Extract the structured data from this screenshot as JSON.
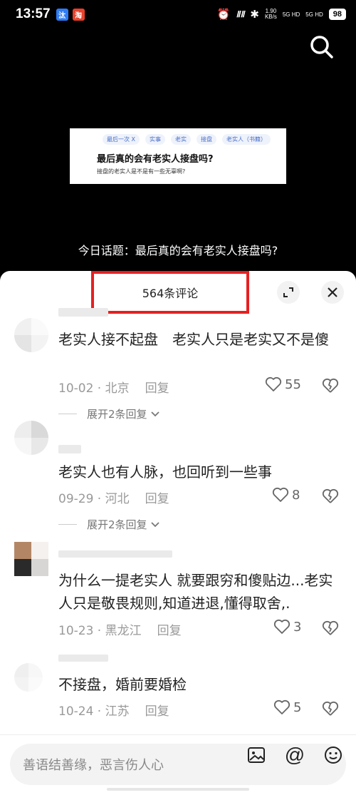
{
  "status": {
    "time": "13:57",
    "badge1": "汰",
    "badge2": "淘",
    "netspeed_top": "1.90",
    "netspeed_bottom": "KB/s",
    "signal1": "5G HD",
    "signal2": "5G HD",
    "battery": "98"
  },
  "video": {
    "tags": [
      "最后一次 X",
      "实事",
      "老实",
      "接盘",
      "老实人（书籍）"
    ],
    "title": "最后真的会有老实人接盘吗?",
    "subtitle": "接盘的老实人是不是有一些无辜啊?",
    "topic": "今日话题：最后真的会有老实人接盘吗?"
  },
  "panel": {
    "title": "564条评论"
  },
  "comments": [
    {
      "text": "老实人接不起盘　老实人只是老实又不是傻",
      "date": "10-02 · 北京",
      "reply": "回复",
      "likes": "55",
      "expand": "展开2条回复"
    },
    {
      "text": "老实人也有人脉，也回听到一些事",
      "date": "09-29 · 河北",
      "reply": "回复",
      "likes": "8",
      "expand": "展开2条回复"
    },
    {
      "text": "为什么一提老实人 就要跟穷和傻贴边...老实人只是敬畏规则,知道进退,懂得取舍,.",
      "date": "10-23 · 黑龙江",
      "reply": "回复",
      "likes": "3"
    },
    {
      "text": "不接盘，婚前要婚检",
      "date": "10-24 · 江苏",
      "reply": "回复",
      "likes": "5"
    }
  ],
  "input": {
    "placeholder": "善语结善缘，恶言伤人心"
  },
  "colors": {
    "highlight": "#e62020",
    "tag_blue": "#4a6fc7"
  },
  "icons": [
    "search-icon",
    "expand-icon",
    "close-icon",
    "heart-icon",
    "broken-heart-icon",
    "chevron-down-icon",
    "image-icon",
    "at-icon",
    "emoji-icon"
  ]
}
